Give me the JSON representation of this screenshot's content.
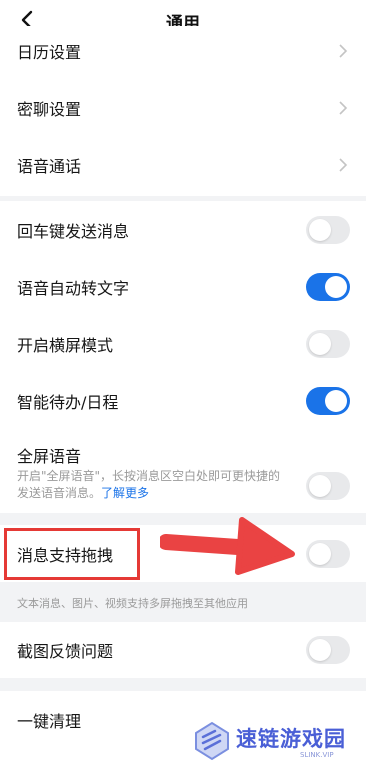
{
  "header": {
    "title": "通用"
  },
  "group1": [
    {
      "label": "日历设置"
    },
    {
      "label": "密聊设置"
    },
    {
      "label": "语音通话"
    }
  ],
  "group2": [
    {
      "label": "回车键发送消息",
      "on": false
    },
    {
      "label": "语音自动转文字",
      "on": true
    },
    {
      "label": "开启横屏模式",
      "on": false
    },
    {
      "label": "智能待办/日程",
      "on": true
    }
  ],
  "fullscreen_voice": {
    "label": "全屏语音",
    "desc": "开启\"全屏语音\"，长按消息区空白处即可更快捷的发送语音消息。",
    "link": "了解更多",
    "on": false
  },
  "drag": {
    "label": "消息支持拖拽",
    "on": false,
    "hint": "文本消息、图片、视频支持多屏拖拽至其他应用"
  },
  "screenshot_feedback": {
    "label": "截图反馈问题",
    "on": false
  },
  "clean": {
    "label": "一键清理"
  },
  "watermark": {
    "text": "速链游戏园",
    "sub": "SLINK.VIP"
  },
  "colors": {
    "accent": "#1a73e8",
    "highlight": "#e53935",
    "toggle_off": "#e8e9eb"
  }
}
